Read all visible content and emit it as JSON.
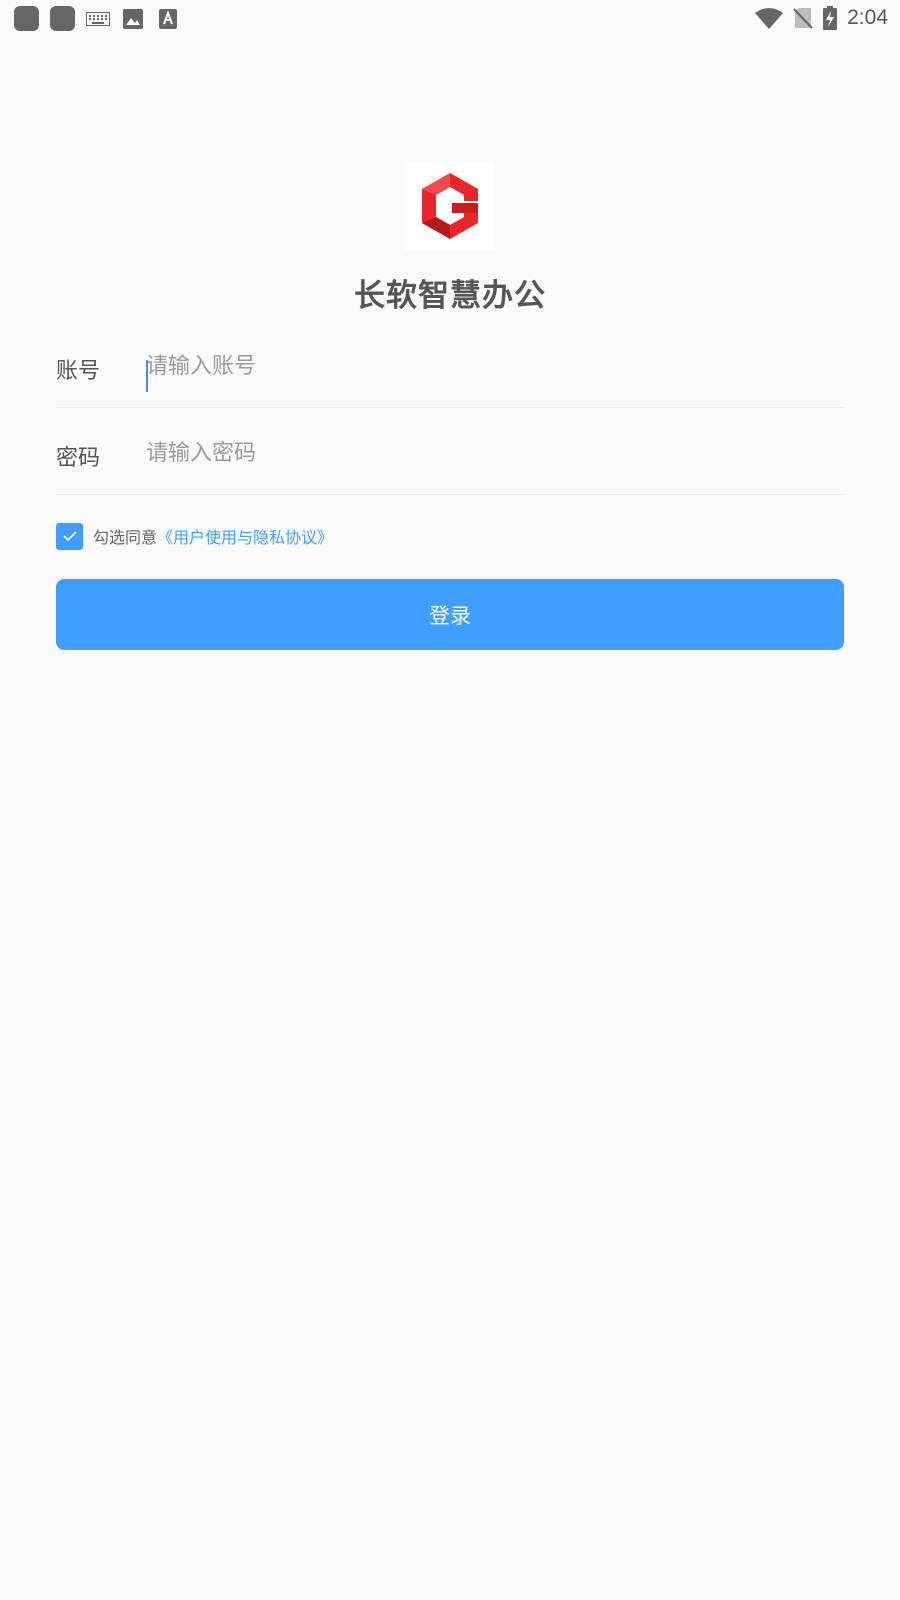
{
  "status_bar": {
    "time": "2:04",
    "icons_left": [
      "app-icon",
      "app-icon",
      "keyboard-icon",
      "image-icon",
      "text-icon"
    ],
    "icons_right": [
      "wifi-icon",
      "no-sim-icon",
      "battery-charging-icon"
    ]
  },
  "app": {
    "title": "长软智慧办公",
    "logo_colors": {
      "primary": "#e8262a",
      "dark": "#b8181b"
    }
  },
  "form": {
    "account": {
      "label": "账号",
      "placeholder": "请输入账号",
      "value": ""
    },
    "password": {
      "label": "密码",
      "placeholder": "请输入密码",
      "value": ""
    },
    "agreement": {
      "checked": true,
      "text": "勾选同意",
      "link": "《用户使用与隐私协议》"
    },
    "login_label": "登录"
  },
  "colors": {
    "accent": "#409eff",
    "text": "#555555",
    "background": "#fafafa"
  }
}
